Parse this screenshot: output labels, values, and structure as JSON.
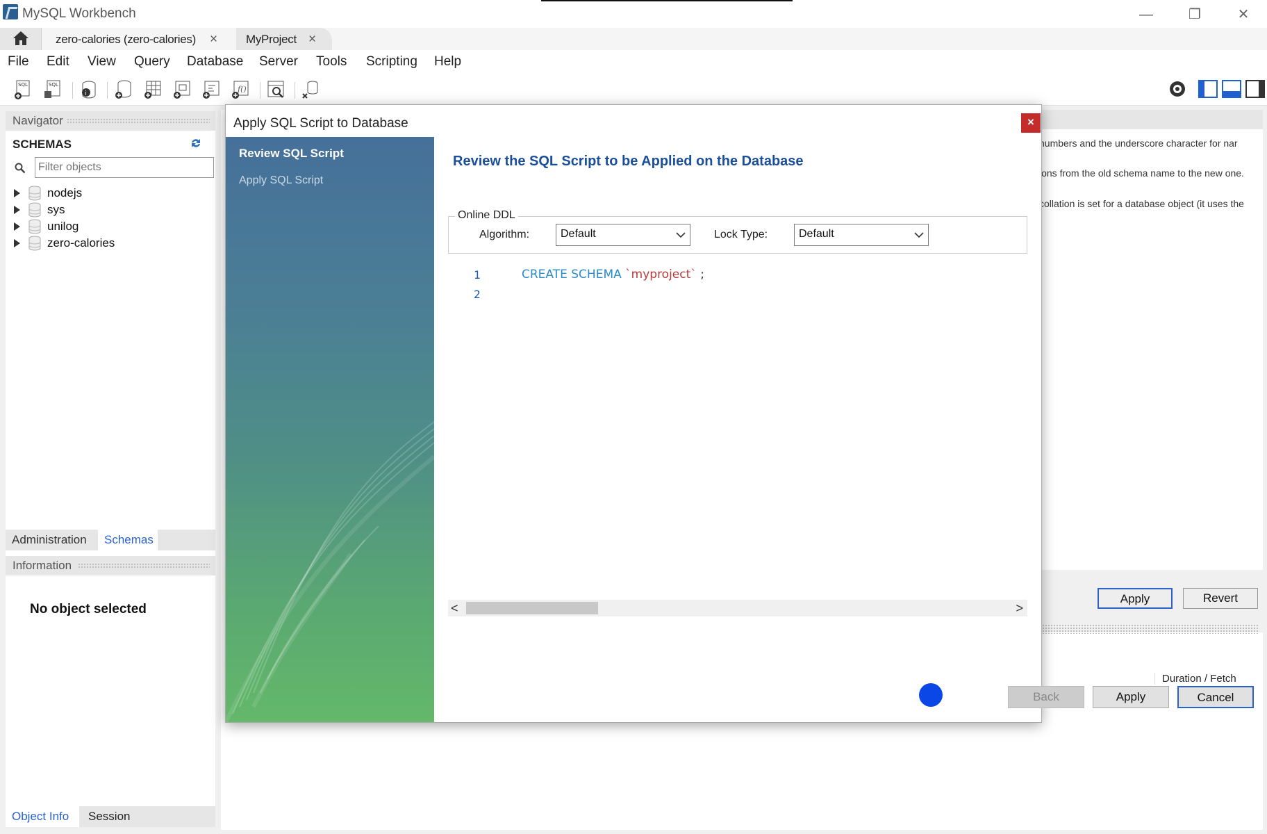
{
  "app": {
    "title": "MySQL Workbench"
  },
  "window_controls": {
    "minimize": "—",
    "restore": "❐",
    "close": "✕"
  },
  "tabs": [
    {
      "label": "zero-calories (zero-calories)",
      "close": "×"
    },
    {
      "label": "MyProject",
      "close": "×"
    }
  ],
  "menu": [
    "File",
    "Edit",
    "View",
    "Query",
    "Database",
    "Server",
    "Tools",
    "Scripting",
    "Help"
  ],
  "navigator": {
    "header": "Navigator",
    "schemas_title": "SCHEMAS",
    "filter_placeholder": "Filter objects",
    "schemas": [
      "nodejs",
      "sys",
      "unilog",
      "zero-calories"
    ],
    "tabs": [
      "Administration",
      "Schemas"
    ],
    "active_tab": "Schemas"
  },
  "information": {
    "header": "Information",
    "empty_text": "No object selected",
    "tabs": [
      "Object Info",
      "Session"
    ]
  },
  "right_panel": {
    "text_lines": [
      "numbers and the underscore character for nar",
      "ions from the old schema name to the new one.",
      "collation is set for a database object (it uses the"
    ],
    "apply_label": "Apply",
    "revert_label": "Revert",
    "duration_label": "Duration / Fetch"
  },
  "dialog": {
    "title": "Apply SQL Script to Database",
    "close": "×",
    "steps": [
      "Review SQL Script",
      "Apply SQL Script"
    ],
    "heading": "Review the SQL Script to be Applied on the Database",
    "online_ddl": {
      "legend": "Online DDL",
      "algorithm_label": "Algorithm:",
      "algorithm_value": "Default",
      "lock_label": "Lock Type:",
      "lock_value": "Default"
    },
    "script": {
      "line_numbers": [
        "1",
        "2"
      ],
      "keyword": "CREATE SCHEMA",
      "identifier": "`myproject`",
      "terminator": ";"
    },
    "scroll": {
      "left": "<",
      "right": ">"
    },
    "buttons": {
      "back": "Back",
      "apply": "Apply",
      "cancel": "Cancel"
    }
  },
  "colors": {
    "accent": "#2a62c8",
    "heading": "#1b4f99",
    "close_red": "#c42b2b"
  }
}
